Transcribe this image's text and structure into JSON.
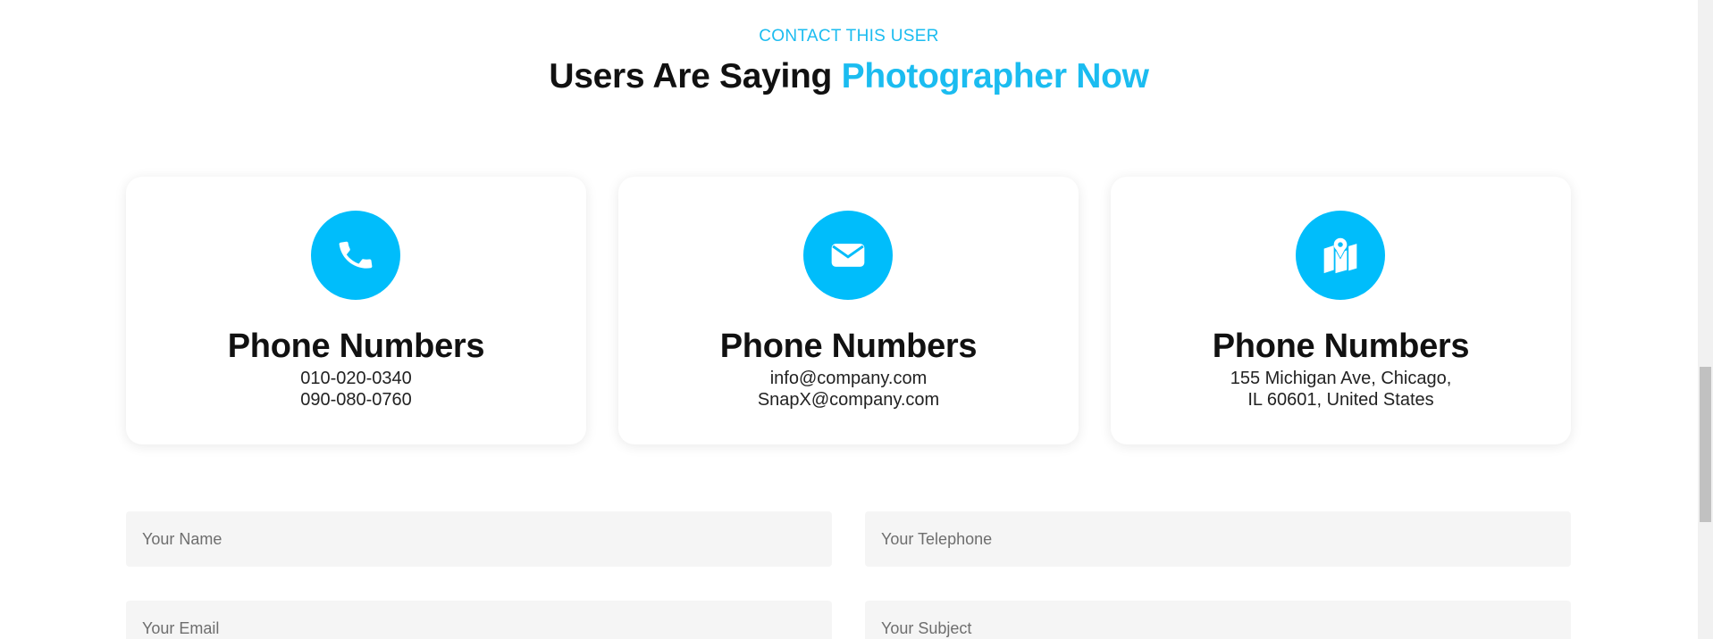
{
  "section": {
    "eyebrow": "CONTACT THIS USER",
    "heading_main": "Users Are Saying ",
    "heading_accent": "Photographer Now",
    "accent_color": "#1bbcf0"
  },
  "cards": [
    {
      "icon": "phone-icon",
      "title": "Phone Numbers",
      "line1": "010-020-0340",
      "line2": "090-080-0760"
    },
    {
      "icon": "envelope-icon",
      "title": "Phone Numbers",
      "line1": "info@company.com",
      "line2": "SnapX@company.com"
    },
    {
      "icon": "map-pin-icon",
      "title": "Phone Numbers",
      "line1": "155 Michigan Ave, Chicago,",
      "line2": "IL 60601, United States"
    }
  ],
  "form": {
    "name_placeholder": "Your Name",
    "telephone_placeholder": "Your Telephone",
    "email_placeholder": "Your Email",
    "subject_placeholder": "Your Subject"
  },
  "colors": {
    "icon_bg": "#00bdfb",
    "field_bg": "#f5f5f5"
  }
}
